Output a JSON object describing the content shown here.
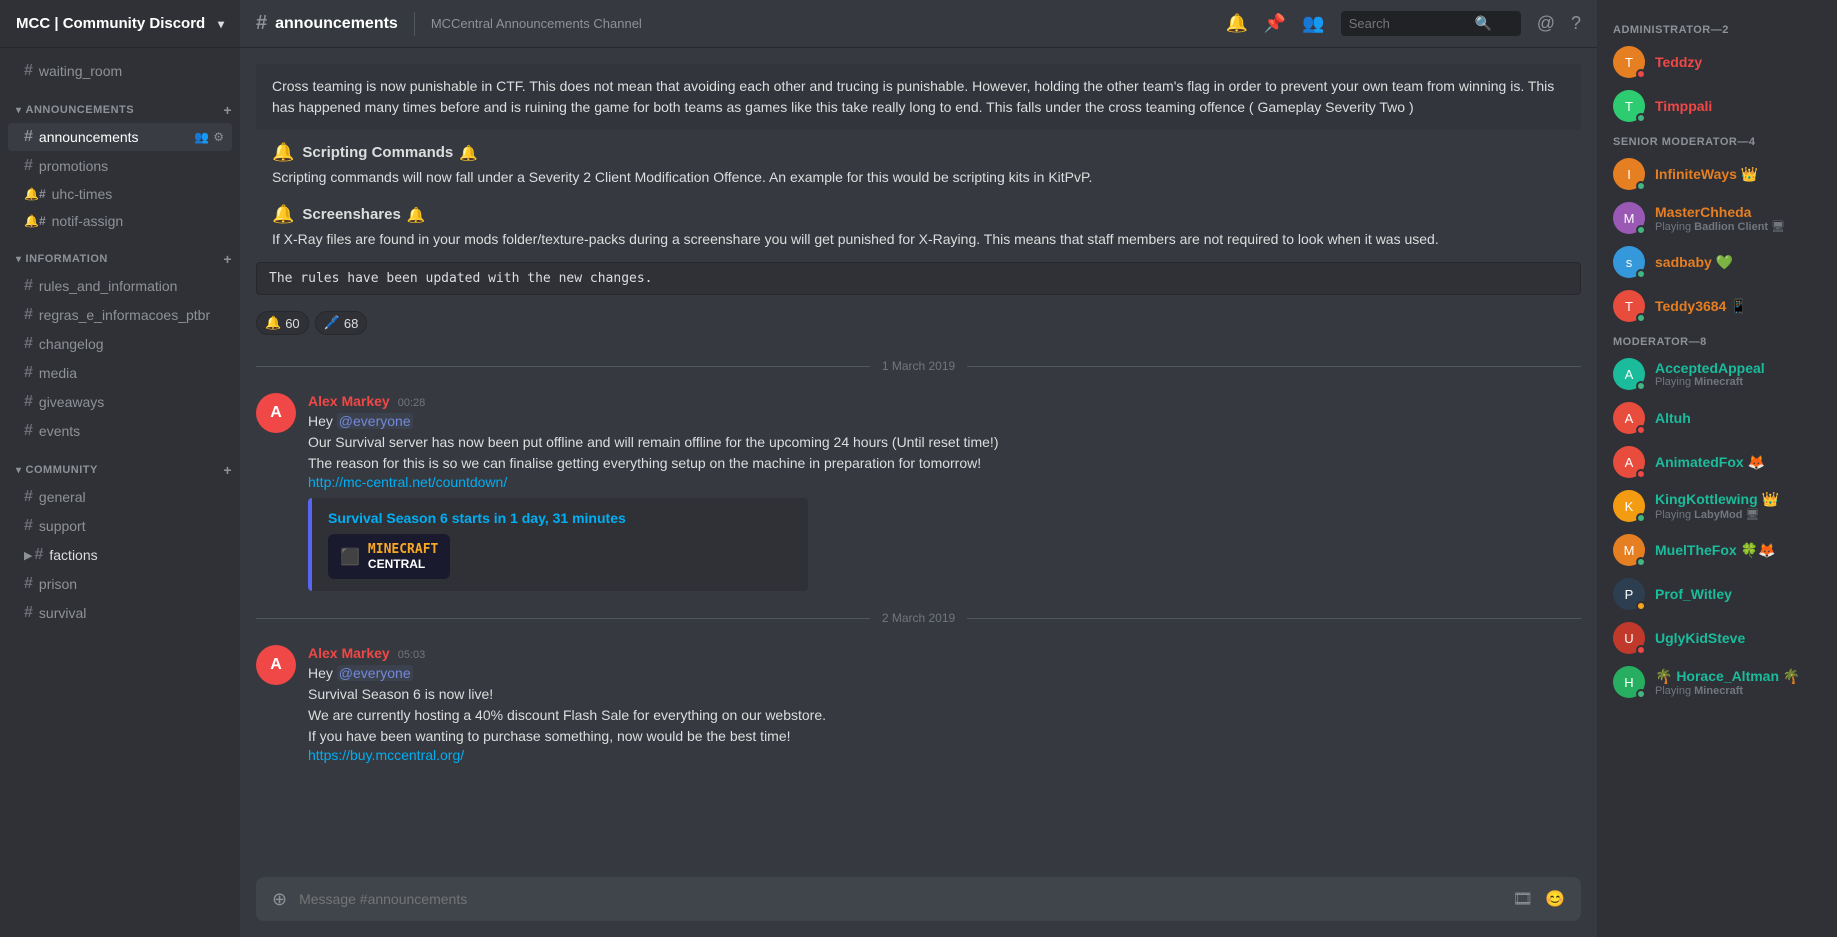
{
  "server": {
    "name": "MCC | Community Discord",
    "icon_label": "MCC"
  },
  "channel_sidebar": {
    "standalone_channels": [
      {
        "id": "waiting_room",
        "name": "waiting_room",
        "type": "hash"
      }
    ],
    "categories": [
      {
        "id": "announcements",
        "name": "ANNOUNCEMENTS",
        "channels": [
          {
            "id": "announcements",
            "name": "announcements",
            "active": true,
            "has_icons": true
          },
          {
            "id": "promotions",
            "name": "promotions",
            "active": false
          },
          {
            "id": "uhc-times",
            "name": "uhc-times",
            "type": "special"
          },
          {
            "id": "notif-assign",
            "name": "notif-assign",
            "type": "special"
          }
        ]
      },
      {
        "id": "information",
        "name": "INFORMATION",
        "channels": [
          {
            "id": "rules_and_information",
            "name": "rules_and_information"
          },
          {
            "id": "regras_e_informacoes_ptbr",
            "name": "regras_e_informacoes_ptbr"
          },
          {
            "id": "changelog",
            "name": "changelog"
          },
          {
            "id": "media",
            "name": "media"
          },
          {
            "id": "giveaways",
            "name": "giveaways"
          },
          {
            "id": "events",
            "name": "events"
          }
        ]
      },
      {
        "id": "community",
        "name": "COMMUNITY",
        "channels": [
          {
            "id": "general",
            "name": "general"
          },
          {
            "id": "support",
            "name": "support"
          },
          {
            "id": "factions",
            "name": "factions",
            "active_partial": true
          },
          {
            "id": "prison",
            "name": "prison"
          },
          {
            "id": "survival",
            "name": "survival"
          }
        ]
      }
    ]
  },
  "channel_header": {
    "hash": "#",
    "name": "announcements",
    "description": "MCCentral Announcements Channel"
  },
  "messages": [
    {
      "id": "msg-cross-team",
      "type": "block",
      "content": "Cross teaming is now punishable in CTF. This does not mean that avoiding each other and trucing is punishable. However, holding the other team's flag in order to prevent your own team from winning is. This has happened many times before and is ruining the game for both teams as games like this take really long to end.  This falls under the cross teaming offence ( Gameplay Severity Two )"
    },
    {
      "id": "msg-scripting",
      "type": "section",
      "title": "Scripting Commands",
      "body": "Scripting commands will now fall under a Severity 2 Client Modification Offence. An example for this would be scripting kits in KitPvP."
    },
    {
      "id": "msg-screenshares",
      "type": "section",
      "title": "Screenshares",
      "body": "If X-Ray files are found in your mods folder/texture-packs during a screenshare you will get punished for X-Raying. This means that staff members are not required to look when it was used."
    },
    {
      "id": "msg-codeline",
      "type": "code",
      "content": "The rules have been updated with the new changes."
    },
    {
      "id": "msg-reactions",
      "type": "reactions",
      "reactions": [
        {
          "emoji": "🔔",
          "count": "60"
        },
        {
          "emoji": "🖊️",
          "count": "68"
        }
      ]
    }
  ],
  "date_dividers": {
    "march1": "1 March 2019",
    "march2": "2 March 2019"
  },
  "chat_messages": [
    {
      "id": "chat1",
      "time": "00:28",
      "author": "Alex Markey",
      "author_color": "red",
      "avatar_color": "#f04747",
      "avatar_letter": "A",
      "mention": "@everyone",
      "text_lines": [
        "Our Survival server has now been put offline and will remain offline for the upcoming 24 hours (Until reset time!)",
        "The reason for this is so we can finalise getting everything setup on the machine in preparation for tomorrow!"
      ],
      "link": "http://mc-central.net/countdown/",
      "embed": {
        "title": "Survival Season 6 starts in 1 day, 31 minutes",
        "logo_text": "MINECRAFT",
        "logo_sub": "CENTRAL"
      }
    },
    {
      "id": "chat2",
      "time": "05:03",
      "author": "Alex Markey",
      "author_color": "red",
      "avatar_color": "#f04747",
      "avatar_letter": "A",
      "mention": "@everyone",
      "text_lines": [
        "Survival Season 6 is now live!",
        "We are currently hosting a 40% discount Flash Sale for everything on our webstore.",
        "If you have been wanting to purchase something, now would be the best time!"
      ],
      "link": "https://buy.mccentral.org/"
    }
  ],
  "message_input": {
    "placeholder": "Message #announcements"
  },
  "right_sidebar": {
    "sections": [
      {
        "id": "administrator",
        "label": "ADMINISTRATOR—2",
        "members": [
          {
            "id": "teddzy",
            "name": "Teddzy",
            "status": "dnd",
            "color_class": "admin",
            "avatar_color": "#e67e22",
            "avatar_letter": "T"
          },
          {
            "id": "timppali",
            "name": "Timppali",
            "status": "online",
            "color_class": "admin",
            "avatar_color": "#2ecc71",
            "avatar_letter": "T",
            "badge": ""
          }
        ]
      },
      {
        "id": "senior-moderator",
        "label": "SENIOR MODERATOR—4",
        "members": [
          {
            "id": "infiniteways",
            "name": "InfiniteWays",
            "status": "online",
            "color_class": "smod",
            "avatar_color": "#e67e22",
            "avatar_letter": "I",
            "badge": "👑",
            "sub": ""
          },
          {
            "id": "masterchheda",
            "name": "MasterChheda",
            "status": "online",
            "color_class": "smod",
            "avatar_color": "#9b59b6",
            "avatar_letter": "M",
            "sub": "Playing Badlion Client 🖥"
          },
          {
            "id": "sadbaby",
            "name": "sadbaby",
            "status": "online",
            "color_class": "smod",
            "avatar_color": "#3498db",
            "avatar_letter": "s",
            "badge": "💚"
          },
          {
            "id": "teddy3684",
            "name": "Teddy3684",
            "status": "online",
            "color_class": "smod",
            "avatar_color": "#e74c3c",
            "avatar_letter": "T",
            "badge": "📱"
          }
        ]
      },
      {
        "id": "moderator",
        "label": "MODERATOR—8",
        "members": [
          {
            "id": "acceptedappeal",
            "name": "AcceptedAppeal",
            "status": "online",
            "color_class": "mod",
            "avatar_color": "#1abc9c",
            "avatar_letter": "A",
            "sub": "Playing Minecraft"
          },
          {
            "id": "altuh",
            "name": "Altuh",
            "status": "dnd",
            "color_class": "mod",
            "avatar_color": "#e74c3c",
            "avatar_letter": "A"
          },
          {
            "id": "animatedfox",
            "name": "AnimatedFox",
            "status": "dnd",
            "color_class": "mod",
            "avatar_color": "#e74c3c",
            "avatar_letter": "A",
            "badge": "🦊"
          },
          {
            "id": "kingkottlewing",
            "name": "KingKottlewing",
            "status": "online",
            "color_class": "mod",
            "avatar_color": "#f39c12",
            "avatar_letter": "K",
            "badge": "👑",
            "sub": "Playing LabyMod 🖥"
          },
          {
            "id": "muelthefox",
            "name": "MuelTheFox",
            "status": "online",
            "color_class": "mod",
            "avatar_color": "#e67e22",
            "avatar_letter": "M",
            "badge": "🍀🦊"
          },
          {
            "id": "prof_witley",
            "name": "Prof_Witley",
            "status": "idle",
            "color_class": "mod",
            "avatar_color": "#2c3e50",
            "avatar_letter": "P"
          },
          {
            "id": "uglykidsteve",
            "name": "UglyKidSteve",
            "status": "dnd",
            "color_class": "mod",
            "avatar_color": "#c0392b",
            "avatar_letter": "U"
          },
          {
            "id": "horace_altman",
            "name": "🌴 Horace_Altman 🌴",
            "status": "online",
            "color_class": "mod",
            "avatar_color": "#27ae60",
            "avatar_letter": "H",
            "sub": "Playing Minecraft"
          }
        ]
      }
    ]
  },
  "header_icons": {
    "bell": "🔔",
    "pin": "📌",
    "members": "👥",
    "at": "@",
    "help": "?"
  },
  "search": {
    "placeholder": "Search"
  }
}
